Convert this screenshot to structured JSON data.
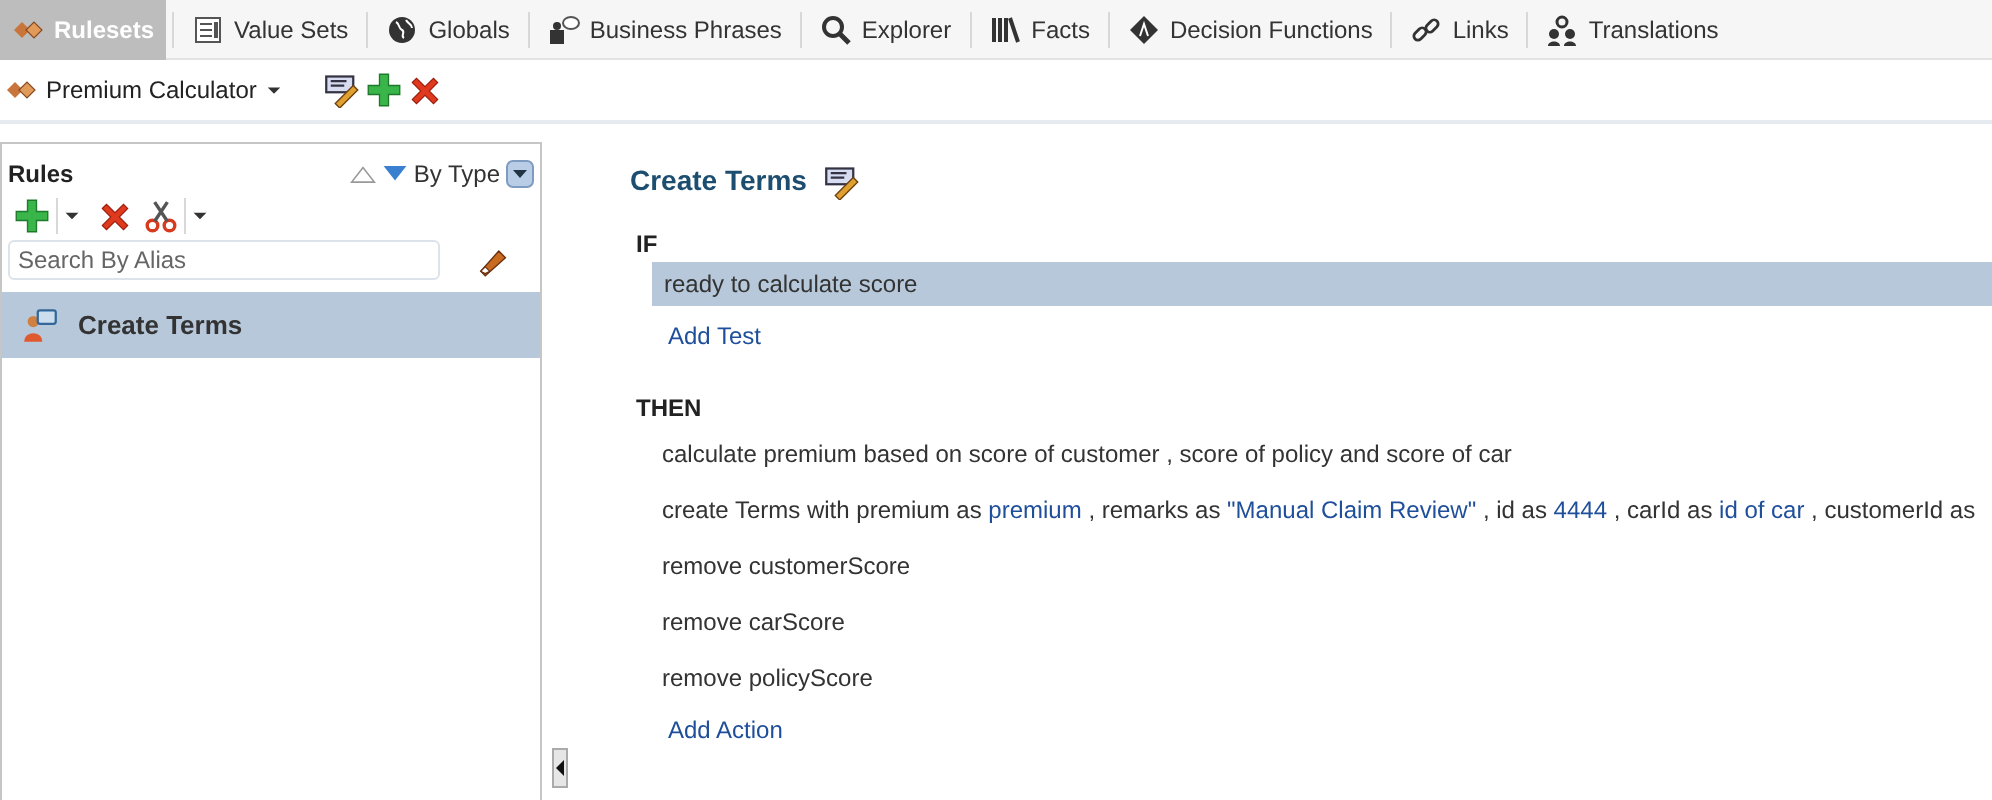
{
  "tabs": [
    {
      "label": "Rulesets",
      "selected": true
    },
    {
      "label": "Value Sets",
      "selected": false
    },
    {
      "label": "Globals",
      "selected": false
    },
    {
      "label": "Business Phrases",
      "selected": false
    },
    {
      "label": "Explorer",
      "selected": false
    },
    {
      "label": "Facts",
      "selected": false
    },
    {
      "label": "Decision Functions",
      "selected": false
    },
    {
      "label": "Links",
      "selected": false
    },
    {
      "label": "Translations",
      "selected": false
    }
  ],
  "ruleset": {
    "name": "Premium Calculator"
  },
  "rules_panel": {
    "title": "Rules",
    "sort": "By Type",
    "search": {
      "placeholder": "Search By Alias"
    },
    "items": [
      {
        "label": "Create Terms",
        "selected": true
      }
    ]
  },
  "rule": {
    "title": "Create Terms",
    "if_label": "IF",
    "tests": [
      {
        "text": "ready to calculate score",
        "selected": true
      }
    ],
    "add_test": "Add Test",
    "then_label": "THEN",
    "actions": [
      {
        "parts": [
          {
            "text": "calculate premium based on score of customer , score of policy and score of car",
            "kind": "text"
          }
        ]
      },
      {
        "parts": [
          {
            "text": "create Terms with premium as ",
            "kind": "text"
          },
          {
            "text": "premium",
            "kind": "value"
          },
          {
            "text": " , remarks as ",
            "kind": "text"
          },
          {
            "text": "\"Manual Claim Review\"",
            "kind": "value"
          },
          {
            "text": " , id as ",
            "kind": "text"
          },
          {
            "text": "4444",
            "kind": "value"
          },
          {
            "text": " , carId as ",
            "kind": "text"
          },
          {
            "text": "id of car",
            "kind": "value"
          },
          {
            "text": " , customerId as",
            "kind": "text"
          }
        ]
      },
      {
        "parts": [
          {
            "text": "remove customerScore",
            "kind": "text"
          }
        ]
      },
      {
        "parts": [
          {
            "text": "remove carScore",
            "kind": "text"
          }
        ]
      },
      {
        "parts": [
          {
            "text": "remove policyScore",
            "kind": "text"
          }
        ]
      }
    ],
    "add_action": "Add Action"
  }
}
